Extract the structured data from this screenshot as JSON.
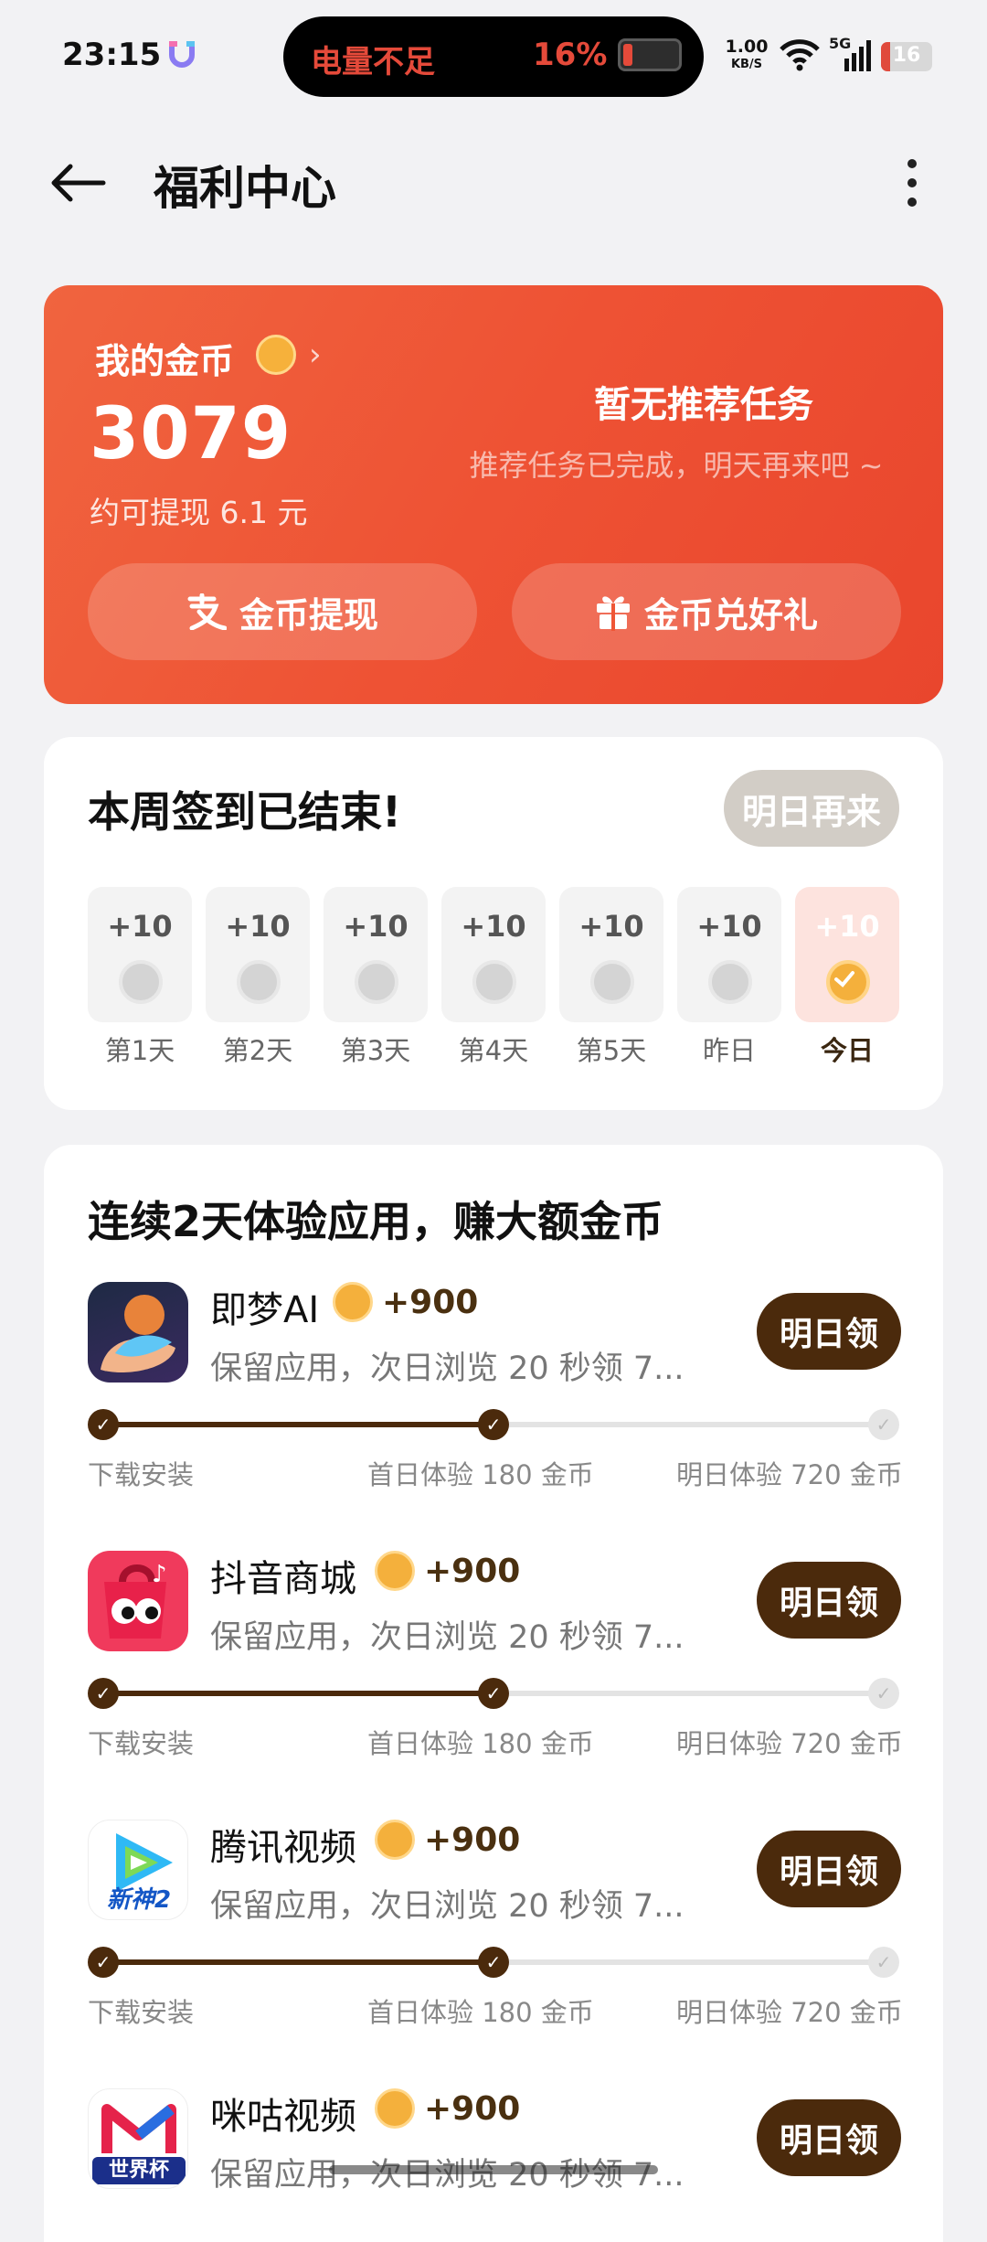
{
  "status_bar": {
    "time": "23:15",
    "low_battery_text": "电量不足",
    "battery_percent": "16%",
    "net_speed": "1.00",
    "net_speed_unit": "KB/S",
    "network_type": "5G",
    "battery_level": "16"
  },
  "header": {
    "title": "福利中心"
  },
  "coin_card": {
    "label": "我的金币",
    "amount": "3079",
    "cash_estimate": "约可提现 6.1 元",
    "no_task_title": "暂无推荐任务",
    "no_task_subtitle": "推荐任务已完成，明天再来吧 ~",
    "withdraw_label": "金币提现",
    "gift_label": "金币兑好礼"
  },
  "checkin": {
    "title": "本周签到已结束!",
    "button_label": "明日再来",
    "days": [
      {
        "points": "+10",
        "label": "第1天"
      },
      {
        "points": "+10",
        "label": "第2天"
      },
      {
        "points": "+10",
        "label": "第3天"
      },
      {
        "points": "+10",
        "label": "第4天"
      },
      {
        "points": "+10",
        "label": "第5天"
      },
      {
        "points": "+10",
        "label": "昨日"
      },
      {
        "points": "+10",
        "label": "今日"
      }
    ]
  },
  "apps_section": {
    "title": "连续2天体验应用，赚大额金币",
    "steps": [
      "下载安装",
      "首日体验 180 金币",
      "明日体验 720 金币"
    ],
    "apps": [
      {
        "name": "即梦AI",
        "bonus": "+900",
        "desc": "保留应用，次日浏览 20 秒领 7...",
        "button": "明日领"
      },
      {
        "name": "抖音商城",
        "bonus": "+900",
        "desc": "保留应用，次日浏览 20 秒领 7...",
        "button": "明日领"
      },
      {
        "name": "腾讯视频",
        "bonus": "+900",
        "desc": "保留应用，次日浏览 20 秒领 7...",
        "button": "明日领"
      },
      {
        "name": "咪咕视频",
        "bonus": "+900",
        "desc": "保留应用，次日浏览 20 秒领 7...",
        "button": "明日领"
      }
    ]
  },
  "app_icon_texts": {
    "tencent_video_badge": "新神2",
    "migu_badge": "世界杯"
  },
  "colors": {
    "card_gradient_start": "#f0643f",
    "card_gradient_end": "#e9462d",
    "claim_button": "#4b2a0c",
    "coin": "#f4b03c"
  }
}
